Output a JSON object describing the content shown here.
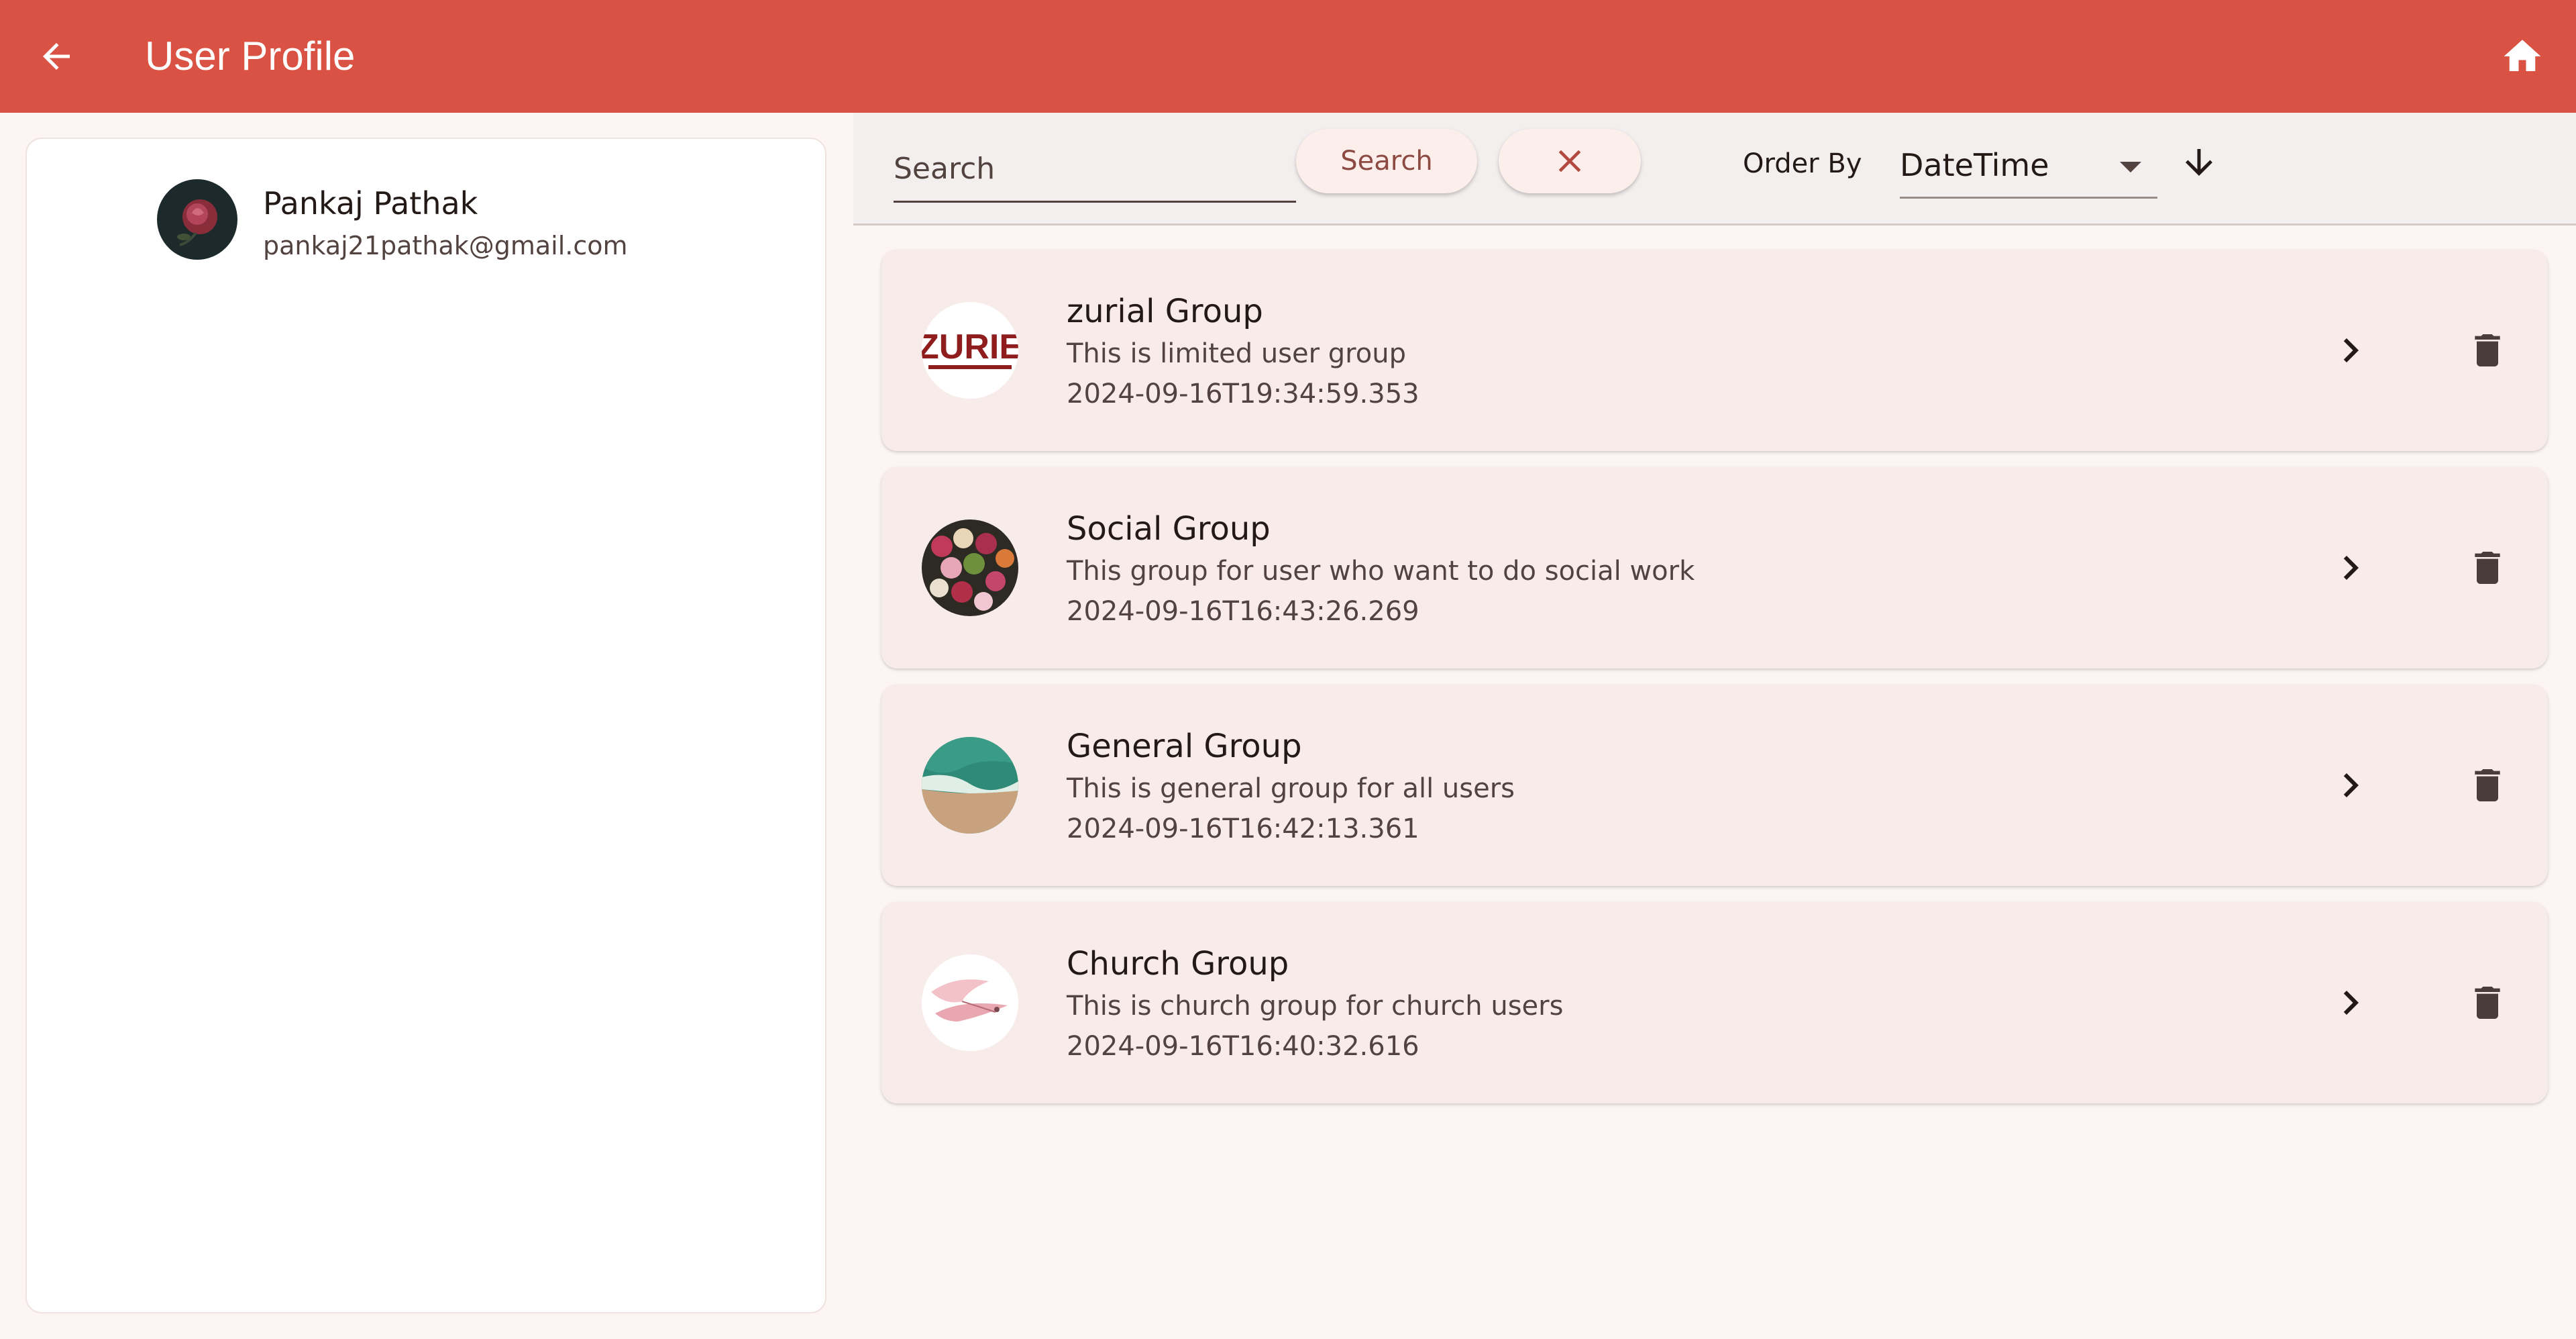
{
  "app_bar": {
    "title": "User Profile",
    "back_icon": "arrow-back-icon",
    "home_icon": "home-icon",
    "color": "#d95243"
  },
  "profile": {
    "name": "Pankaj Pathak",
    "email": "pankaj21pathak@gmail.com",
    "avatar_icon": "rose-avatar"
  },
  "toolbar": {
    "search_placeholder": "Search",
    "search_button_label": "Search",
    "clear_icon": "close-icon",
    "order_by_label": "Order By",
    "order_by_value": "DateTime",
    "sort_direction_icon": "arrow-down-icon"
  },
  "groups": [
    {
      "name": "zurial Group",
      "description": "This is limited user group",
      "datetime": "2024-09-16T19:34:59.353",
      "avatar": "zurie-logo",
      "avatar_text": "ZURIE"
    },
    {
      "name": "Social Group",
      "description": "This group for user who want to do social work",
      "datetime": "2024-09-16T16:43:26.269",
      "avatar": "flowers-photo"
    },
    {
      "name": "General Group",
      "description": "This is general group for all users",
      "datetime": "2024-09-16T16:42:13.361",
      "avatar": "beach-aerial-photo"
    },
    {
      "name": "Church Group",
      "description": "This is church group for church users",
      "datetime": "2024-09-16T16:40:32.616",
      "avatar": "bird-illustration"
    }
  ],
  "colors": {
    "accent": "#d95243",
    "card_background": "#f8ecea",
    "page_background": "#fcf5f3",
    "button_text": "#8c4a42"
  }
}
